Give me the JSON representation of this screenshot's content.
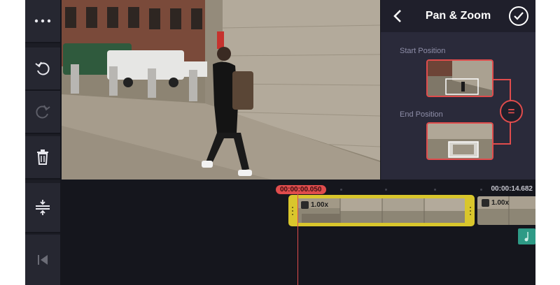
{
  "toolbar": {
    "items": [
      {
        "name": "more-options",
        "icon": "ellipsis-icon"
      },
      {
        "name": "undo",
        "icon": "undo-icon"
      },
      {
        "name": "redo",
        "icon": "redo-icon",
        "disabled": true
      },
      {
        "name": "delete",
        "icon": "trash-icon"
      },
      {
        "name": "expand-timeline",
        "icon": "expand-vertical-icon"
      },
      {
        "name": "jump-to-start",
        "icon": "skip-to-start-icon"
      }
    ]
  },
  "panel": {
    "title": "Pan & Zoom",
    "back_icon": "chevron-left-icon",
    "confirm_icon": "check-circle-icon",
    "start_label": "Start Position",
    "end_label": "End Position",
    "equal_symbol": "=",
    "accent_color": "#e04c4c"
  },
  "timeline": {
    "current_time": "00:00:00.050",
    "total_time": "00:00:14.682",
    "selected_clip": {
      "speed": "1.00x",
      "border_color": "#d9c62c"
    },
    "next_clip": {
      "speed": "1.00x"
    },
    "audio_clip_color": "#2e9a86"
  }
}
